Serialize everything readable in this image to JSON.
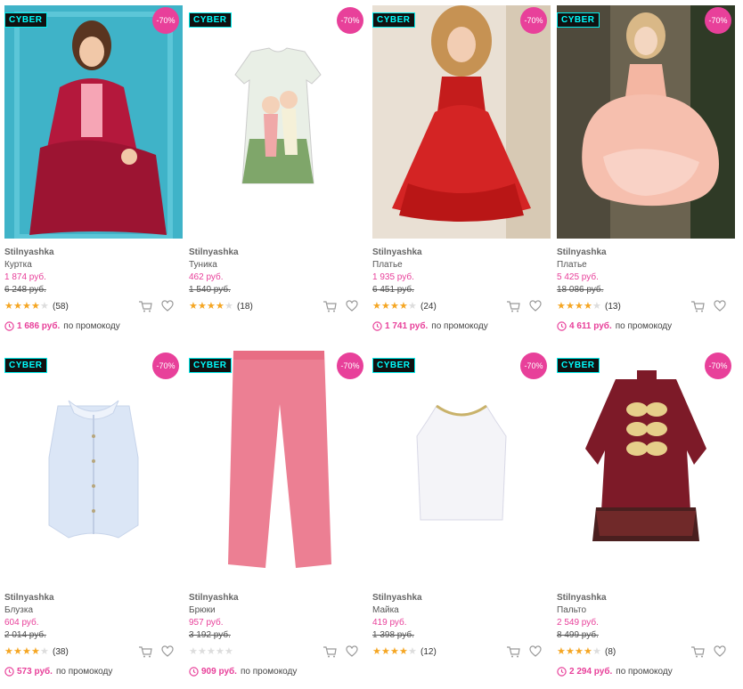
{
  "colors": {
    "accent": "#e8409a",
    "star": "#f5a623",
    "cyber_text": "#00ffff"
  },
  "products": [
    {
      "cyber": "CYBER",
      "discount": "-70%",
      "brand": "Stilnyashka",
      "type": "Куртка",
      "price": "1 874 руб.",
      "old_price": "6 248 руб.",
      "rating": 4,
      "reviews": "(58)",
      "promo_price": "1 686 руб.",
      "promo_label": "по промокоду"
    },
    {
      "cyber": "CYBER",
      "discount": "-70%",
      "brand": "Stilnyashka",
      "type": "Туника",
      "price": "462 руб.",
      "old_price": "1 540 руб.",
      "rating": 4,
      "reviews": "(18)",
      "promo_price": "",
      "promo_label": ""
    },
    {
      "cyber": "CYBER",
      "discount": "-70%",
      "brand": "Stilnyashka",
      "type": "Платье",
      "price": "1 935 руб.",
      "old_price": "6 451 руб.",
      "rating": 4,
      "reviews": "(24)",
      "promo_price": "1 741 руб.",
      "promo_label": "по промокоду"
    },
    {
      "cyber": "CYBER",
      "discount": "-70%",
      "brand": "Stilnyashka",
      "type": "Платье",
      "price": "5 425 руб.",
      "old_price": "18 086 руб.",
      "rating": 4,
      "reviews": "(13)",
      "promo_price": "4 611 руб.",
      "promo_label": "по промокоду"
    },
    {
      "cyber": "CYBER",
      "discount": "-70%",
      "brand": "Stilnyashka",
      "type": "Блузка",
      "price": "604 руб.",
      "old_price": "2 014 руб.",
      "rating": 4,
      "reviews": "(38)",
      "promo_price": "573 руб.",
      "promo_label": "по промокоду"
    },
    {
      "cyber": "CYBER",
      "discount": "-70%",
      "brand": "Stilnyashka",
      "type": "Брюки",
      "price": "957 руб.",
      "old_price": "3 192 руб.",
      "rating": 0,
      "reviews": "",
      "promo_price": "909 руб.",
      "promo_label": "по промокоду"
    },
    {
      "cyber": "CYBER",
      "discount": "-70%",
      "brand": "Stilnyashka",
      "type": "Майка",
      "price": "419 руб.",
      "old_price": "1 398 руб.",
      "rating": 4,
      "reviews": "(12)",
      "promo_price": "",
      "promo_label": ""
    },
    {
      "cyber": "CYBER",
      "discount": "-70%",
      "brand": "Stilnyashka",
      "type": "Пальто",
      "price": "2 549 руб.",
      "old_price": "8 499 руб.",
      "rating": 4,
      "reviews": "(8)",
      "promo_price": "2 294 руб.",
      "promo_label": "по промокоду"
    }
  ]
}
